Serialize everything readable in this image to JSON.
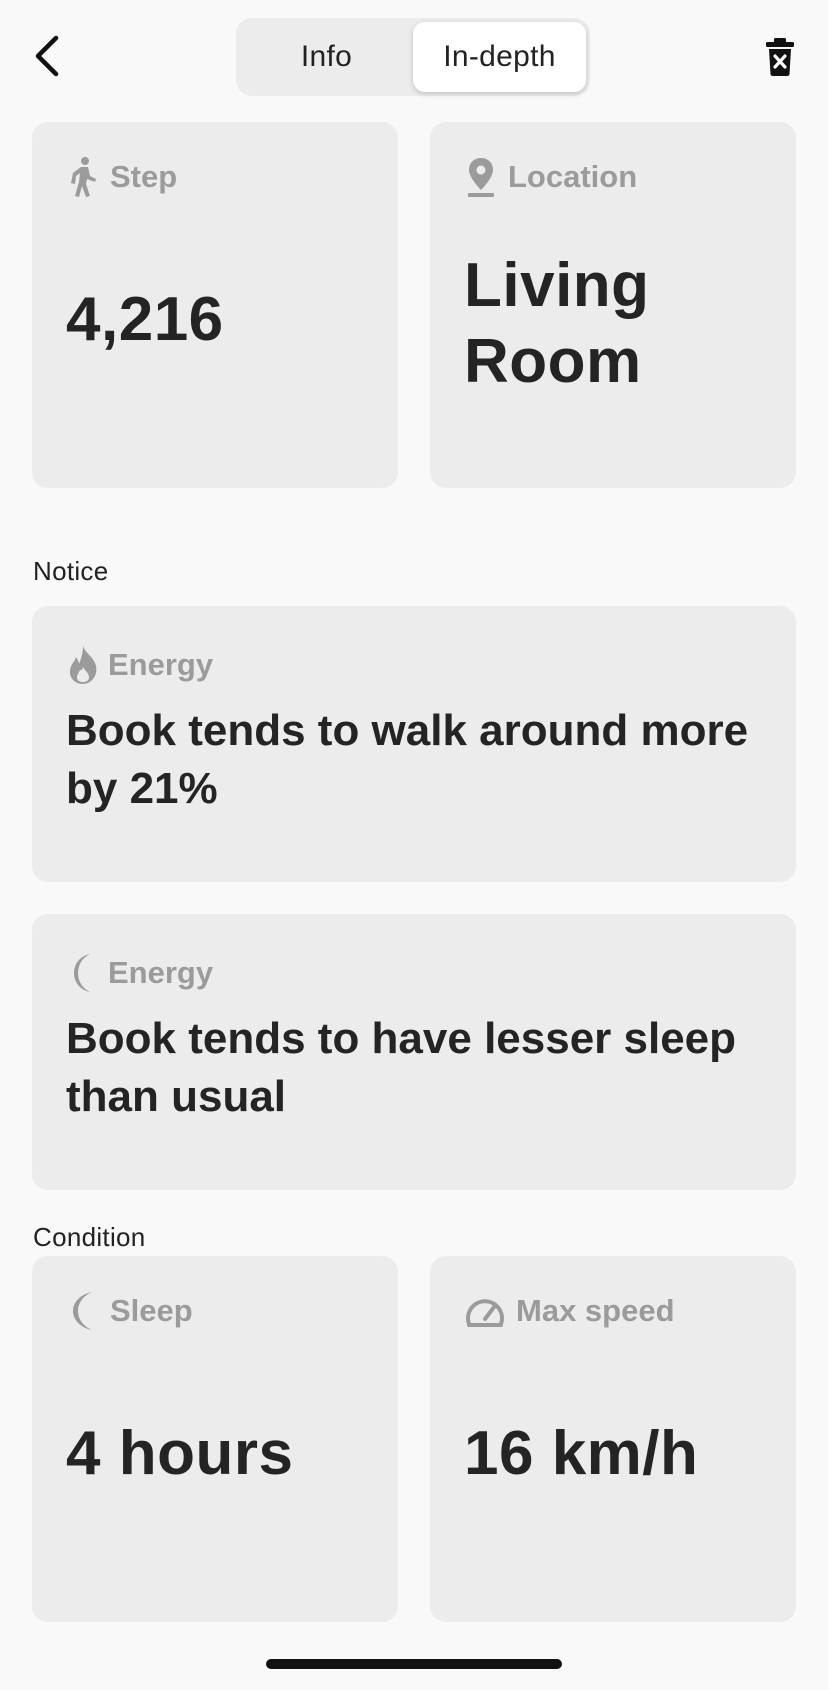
{
  "header": {
    "back_icon": "chevron-left-icon",
    "tabs": [
      {
        "label": "Info",
        "active": false
      },
      {
        "label": "In-depth",
        "active": true
      }
    ],
    "delete_icon": "trash-icon"
  },
  "stats_top": {
    "step": {
      "label": "Step",
      "icon": "walking-icon",
      "value": "4,216"
    },
    "location": {
      "label": "Location",
      "icon": "map-pin-icon",
      "value_line1": "Living",
      "value_line2": "Room"
    }
  },
  "notice": {
    "label": "Notice",
    "items": [
      {
        "label": "Energy",
        "icon": "flame-icon",
        "text": "Book tends to walk around more by 21%"
      },
      {
        "label": "Energy",
        "icon": "moon-icon",
        "text": "Book tends to have lesser sleep than usual"
      }
    ]
  },
  "condition": {
    "label": "Condition",
    "sleep": {
      "label": "Sleep",
      "icon": "moon-icon",
      "value": "4 hours"
    },
    "max_speed": {
      "label": "Max speed",
      "icon": "speedometer-icon",
      "value": "16 km/h"
    }
  },
  "colors": {
    "background": "#f9f9f9",
    "card": "#ececec",
    "muted_label": "#9b9b9b",
    "text": "#242424"
  }
}
